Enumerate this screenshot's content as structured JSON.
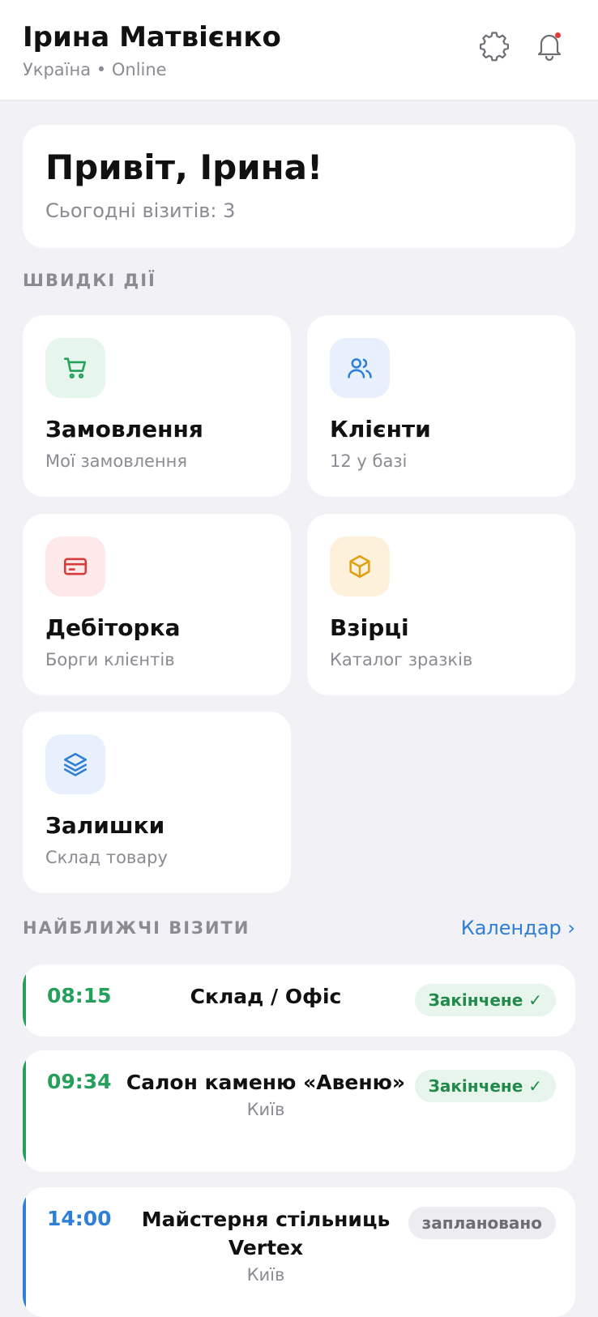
{
  "header": {
    "name": "Ірина Матвієнко",
    "status": "Україна • Online",
    "settings_icon": "gear-icon",
    "notification_icon": "bell-icon"
  },
  "greeting": {
    "title": "Привіт, Ірина!",
    "subtitle": "Сьогодні візитів: 3"
  },
  "quick_actions": {
    "label": "ШВИДКІ ДІЇ",
    "tiles": [
      {
        "title": "Замовлення",
        "subtitle": "Мої замовлення",
        "icon": "cart-icon",
        "color": "#24a05a",
        "bg": "#e6f6ec"
      },
      {
        "title": "Клієнти",
        "subtitle": "12 у базі",
        "icon": "users-icon",
        "color": "#2f7fd8",
        "bg": "#e7f0fc"
      },
      {
        "title": "Дебіторка",
        "subtitle": "Борги клієнтів",
        "icon": "credit-card-icon",
        "color": "#d83b3b",
        "bg": "#fde9e9"
      },
      {
        "title": "Взірці",
        "subtitle": "Каталог зразків",
        "icon": "box-icon",
        "color": "#e0a013",
        "bg": "#fdf1dc"
      },
      {
        "title": "Залишки",
        "subtitle": "Склад товару",
        "icon": "layers-icon",
        "color": "#2f7fd8",
        "bg": "#e7f0fc"
      }
    ]
  },
  "visits": {
    "label": "НАЙБЛИЖЧІ ВІЗИТИ",
    "calendar_link": "Календар ›",
    "items": [
      {
        "time": "08:15",
        "name": "Склад / Офіс",
        "city": "",
        "status": "Закінчене ✓",
        "accent": "#24a05a"
      },
      {
        "time": "09:34",
        "name": "Салон каменю «Авеню»",
        "city": "Київ",
        "status": "Закінчене ✓",
        "accent": "#24a05a"
      },
      {
        "time": "14:00",
        "name": "Майстерня стільниць Vertex",
        "city": "Київ",
        "status": "заплановано",
        "accent": "#2f7fd8"
      }
    ]
  }
}
